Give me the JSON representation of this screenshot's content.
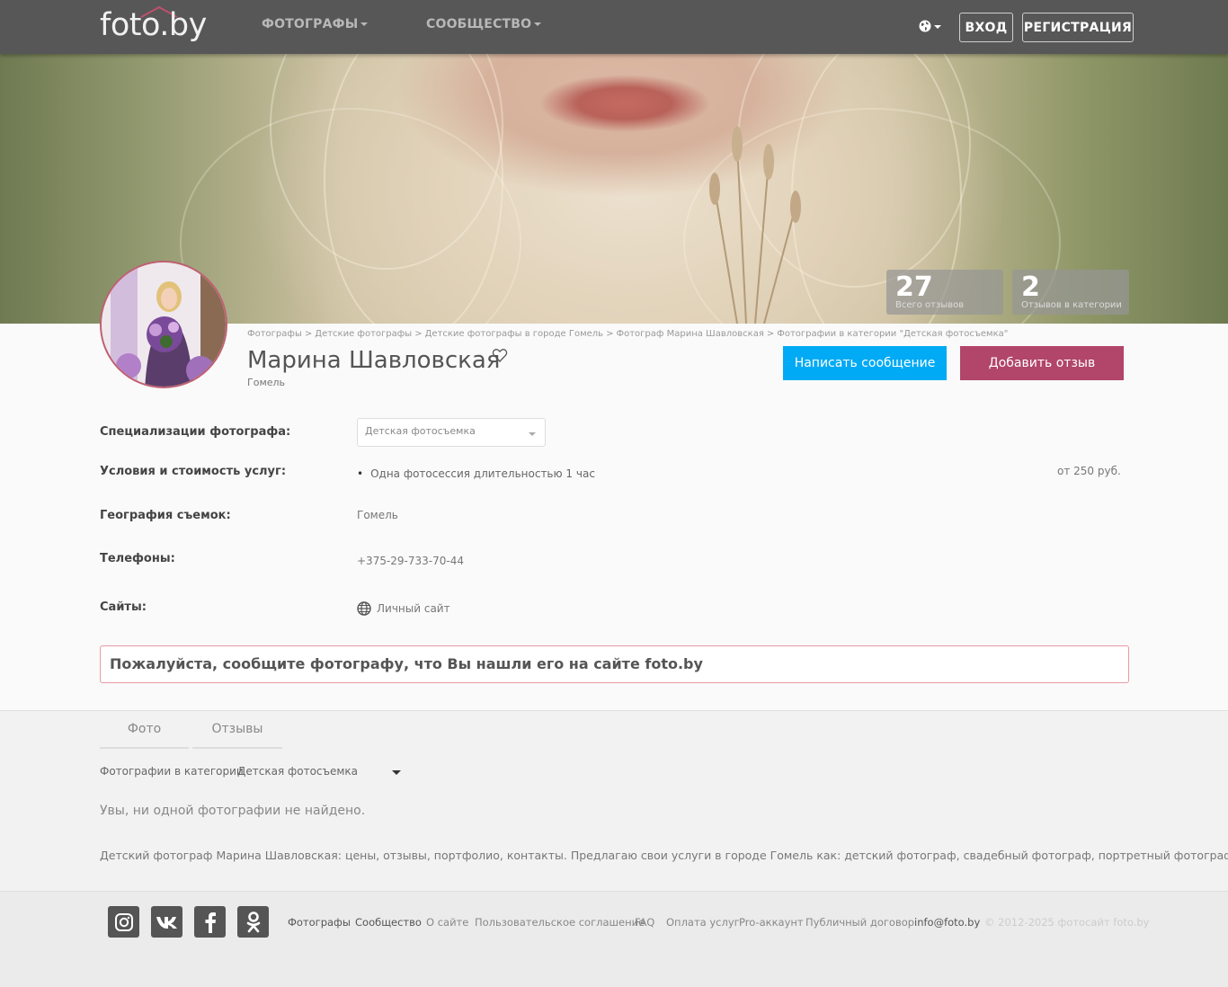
{
  "header": {
    "logo_text": "foto.by",
    "nav": [
      {
        "label": "ФОТОГРАФЫ"
      },
      {
        "label": "СООБЩЕСТВО"
      }
    ],
    "login_label": "ВХОД",
    "register_label": "РЕГИСТРАЦИЯ"
  },
  "stats": [
    {
      "value": "27",
      "label": "Всего отзывов"
    },
    {
      "value": "2",
      "label": "Отзывов в категории"
    }
  ],
  "breadcrumbs": [
    "Фотографы",
    "Детские фотографы",
    "Детские фотографы в городе Гомель",
    "Фотограф Марина Шавловская",
    "Фотографии в категории \"Детская фотосъемка\""
  ],
  "profile": {
    "name": "Марина Шавловская",
    "city": "Гомель",
    "message_button": "Написать сообщение",
    "review_button": "Добавить отзыв"
  },
  "details": {
    "specializations_label": "Специализации фотографа:",
    "specialization_value": "Детская фотосъемка",
    "services_label": "Условия и стоимость услуг:",
    "service_item": "Одна фотосессия длительностью 1 час",
    "service_price": "от 250 руб.",
    "geo_label": "География съемок:",
    "geo_value": "Гомель",
    "phones_label": "Телефоны:",
    "phone_value": "+375-29-733-70-44",
    "sites_label": "Сайты:",
    "site_value": "Личный сайт"
  },
  "notice": "Пожалуйста, сообщите фотографу, что Вы нашли его на сайте foto.by",
  "tabs": [
    {
      "label": "Фото"
    },
    {
      "label": "Отзывы"
    }
  ],
  "category_filter": {
    "label": "Фотографии в категории",
    "selected": "Детская фотосъемка"
  },
  "empty_message": "Увы, ни одной фотографии не найдено.",
  "seo_text": "Детский фотограф Марина Шавловская: цены, отзывы, портфолио, контакты. Предлагаю свои услуги в городе Гомель как: детский фотограф, свадебный фотограф, портретный фотограф.",
  "footer": {
    "social": [
      "instagram-icon",
      "vk-icon",
      "facebook-icon",
      "odnoklassniki-icon"
    ],
    "links": [
      "Фотографы",
      "Сообщество",
      "О сайте",
      "Пользовательское соглашение",
      "FAQ",
      "Оплата услуг",
      "Pro-аккаунт",
      "Публичный договор",
      "info@foto.by"
    ],
    "copyright": "© 2012-2025 фотосайт foto.by"
  },
  "colors": {
    "header_bg": "#575757",
    "accent_blue": "#00aaf5",
    "accent_pink": "#b1456a",
    "notice_border": "#e79aa5"
  }
}
